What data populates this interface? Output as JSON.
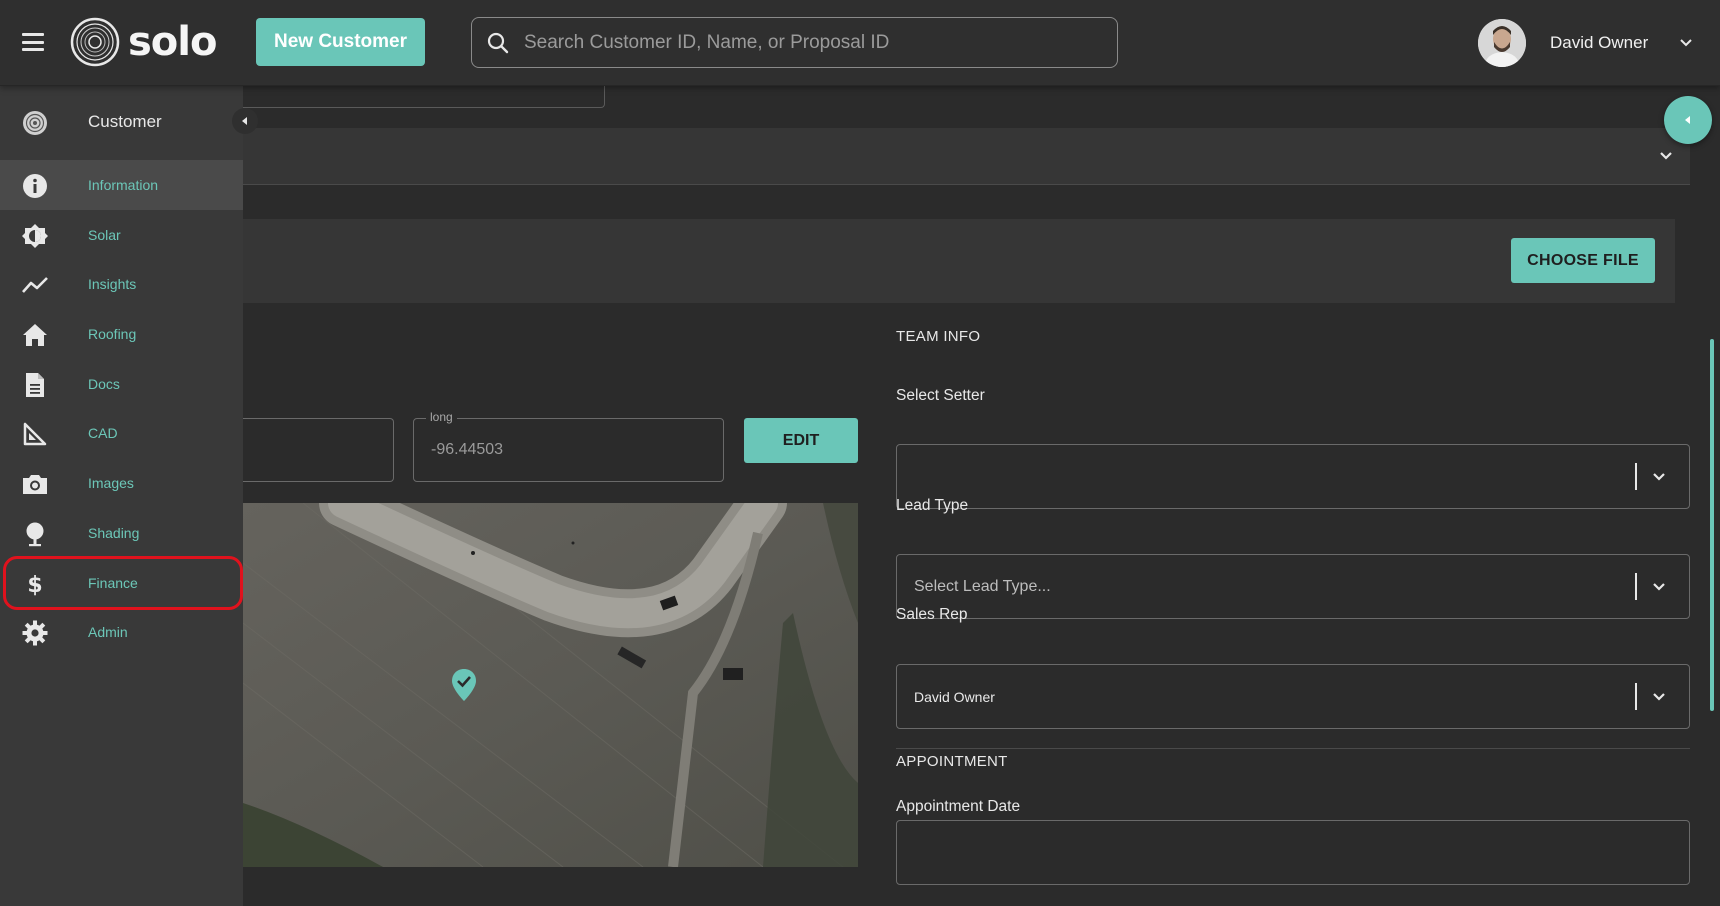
{
  "header": {
    "logo_text": "solo",
    "new_customer_label": "New Customer",
    "search_placeholder": "Search Customer ID, Name, or Proposal ID",
    "user_name": "David Owner"
  },
  "sidebar": {
    "title": "Customer",
    "items": [
      {
        "label": "Information",
        "icon": "info-icon",
        "active": true
      },
      {
        "label": "Solar",
        "icon": "brightness-icon"
      },
      {
        "label": "Insights",
        "icon": "trend-line-icon"
      },
      {
        "label": "Roofing",
        "icon": "home-icon"
      },
      {
        "label": "Docs",
        "icon": "document-icon"
      },
      {
        "label": "CAD",
        "icon": "set-square-icon"
      },
      {
        "label": "Images",
        "icon": "camera-icon"
      },
      {
        "label": "Shading",
        "icon": "tree-icon"
      },
      {
        "label": "Finance",
        "icon": "dollar-icon",
        "highlighted": true
      },
      {
        "label": "Admin",
        "icon": "gear-icon"
      }
    ]
  },
  "files": {
    "choose_file_label": "CHOOSE FILE"
  },
  "location": {
    "long_label": "long",
    "long_value": "-96.44503",
    "edit_label": "EDIT"
  },
  "team_info": {
    "title": "TEAM INFO",
    "setter_label": "Select Setter",
    "setter_value": "",
    "lead_type_label": "Lead Type",
    "lead_type_placeholder": "Select Lead Type...",
    "sales_rep_label": "Sales Rep",
    "sales_rep_value": "David Owner"
  },
  "appointment": {
    "title": "APPOINTMENT",
    "date_label": "Appointment Date",
    "date_value": ""
  },
  "colors": {
    "accent": "#6ac6b8",
    "highlight_ring": "#e0121d",
    "background": "#2b2b2b",
    "sidebar": "#393939"
  }
}
